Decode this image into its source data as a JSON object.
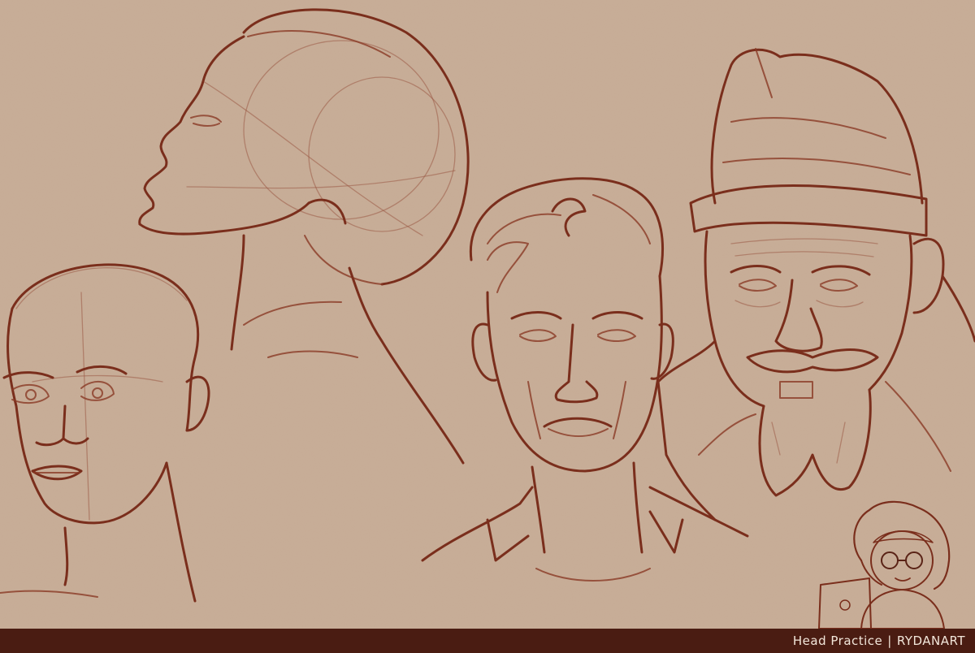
{
  "footer": {
    "title": "Head Practice",
    "separator": "|",
    "artist": "RYDANART"
  }
}
